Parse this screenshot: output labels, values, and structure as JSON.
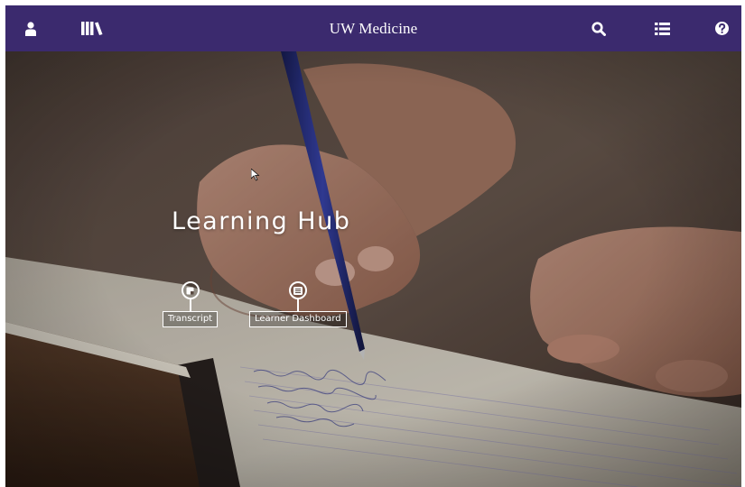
{
  "header": {
    "brand": "UW Medicine",
    "background_color": "#3b2a6e",
    "left_icons": [
      "user-icon",
      "library-books-icon"
    ],
    "right_icons": [
      "search-icon",
      "list-icon",
      "help-icon"
    ]
  },
  "hero": {
    "title": "Learning Hub",
    "links": [
      {
        "label": "Transcript",
        "icon": "transcript-icon"
      },
      {
        "label": "Learner Dashboard",
        "icon": "dashboard-icon"
      }
    ]
  }
}
